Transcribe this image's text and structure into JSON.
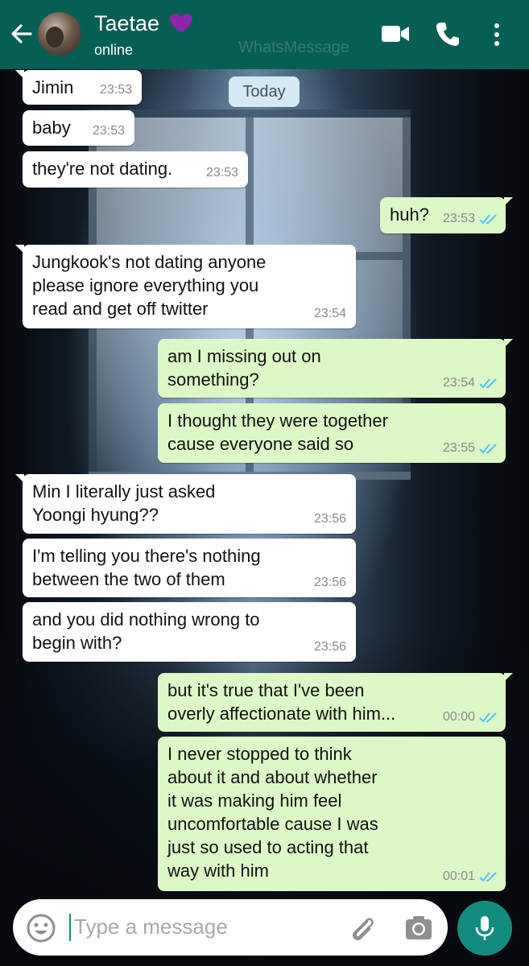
{
  "header": {
    "contact_name": "Taetae",
    "status": "online",
    "watermark": "WhatsMessage"
  },
  "date_chip": "Today",
  "messages": [
    {
      "dir": "in",
      "text": "Jimin",
      "time": "23:53"
    },
    {
      "dir": "in",
      "text": "baby",
      "time": "23:53"
    },
    {
      "dir": "in",
      "text": "they're not dating.",
      "time": "23:53"
    },
    {
      "dir": "out",
      "text": "huh?",
      "time": "23:53",
      "status": "read"
    },
    {
      "dir": "in",
      "text": "Jungkook's not dating anyone\nplease ignore everything you\nread and get off twitter",
      "time": "23:54"
    },
    {
      "dir": "out",
      "text": "am I missing out on\nsomething?",
      "time": "23:54",
      "status": "read"
    },
    {
      "dir": "out",
      "text": "I thought they were together\ncause everyone said so",
      "time": "23:55",
      "status": "read"
    },
    {
      "dir": "in",
      "text": "Min I literally just asked\nYoongi hyung??",
      "time": "23:56"
    },
    {
      "dir": "in",
      "text": "I'm telling you there's nothing\nbetween the two of them",
      "time": "23:56"
    },
    {
      "dir": "in",
      "text": "and you did nothing wrong to\nbegin with?",
      "time": "23:56"
    },
    {
      "dir": "out",
      "text": "but it's true that I've been\noverly affectionate with him...",
      "time": "00:00",
      "status": "read"
    },
    {
      "dir": "out",
      "text": "I never stopped to think\nabout it and about whether\nit was making him feel\nuncomfortable cause I was\njust so used to acting that\nway with him",
      "time": "00:01",
      "status": "read"
    }
  ],
  "input": {
    "placeholder": "Type a message"
  },
  "icons": {
    "back": "arrow-back-icon",
    "heart": "purple-heart-icon",
    "video": "video-call-icon",
    "call": "phone-icon",
    "menu": "more-vert-icon",
    "emoji": "emoji-icon",
    "attach": "paperclip-icon",
    "camera": "camera-icon",
    "mic": "mic-icon",
    "read": "double-check-icon"
  },
  "colors": {
    "header": "#075e54",
    "outgoing_bubble": "#dcf8c6",
    "incoming_bubble": "#ffffff",
    "read_check": "#4fc3f7",
    "heart": "#8e24aa",
    "mic_button": "#128c7e"
  }
}
